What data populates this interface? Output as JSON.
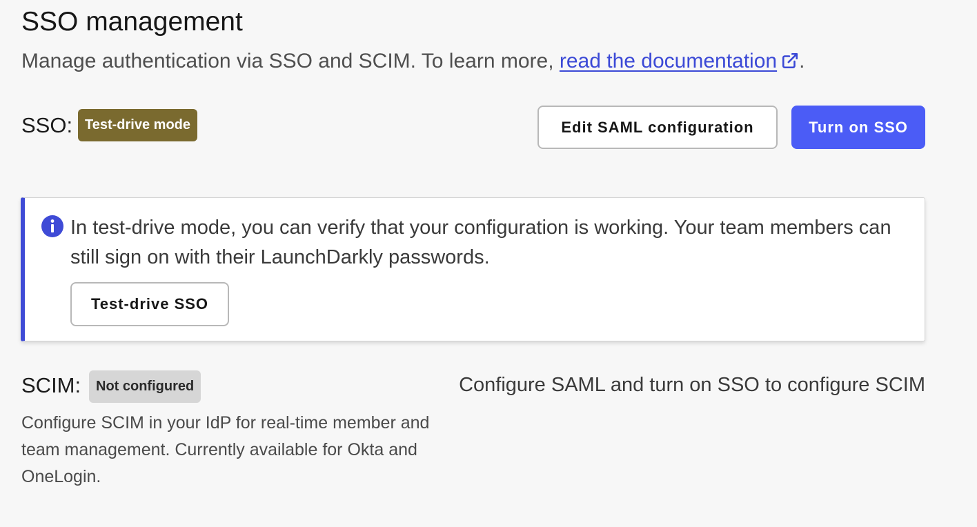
{
  "page": {
    "title": "SSO management",
    "subtitle_text": "Manage authentication via SSO and SCIM. To learn more, ",
    "doc_link_text": "read the documentation",
    "subtitle_end": "."
  },
  "sso": {
    "label": "SSO:",
    "status_badge": "Test-drive mode",
    "edit_button": "Edit SAML configuration",
    "turn_on_button": "Turn on SSO"
  },
  "callout": {
    "icon": "info-icon",
    "text": "In test-drive mode, you can verify that your configuration is working. Your team members can still sign on with their LaunchDarkly passwords.",
    "button": "Test-drive SSO"
  },
  "scim": {
    "label": "SCIM:",
    "status_badge": "Not configured",
    "description": "Configure SCIM in your IdP for real-time member and team management. Currently available for Okta and OneLogin.",
    "hint": "Configure SAML and turn on SSO to configure SCIM"
  },
  "colors": {
    "background": "#f7f7f7",
    "link": "#3b49d6",
    "primary_button": "#4b5cf6",
    "test_drive_badge": "#7a6a2f",
    "not_configured_badge": "#d6d6d6",
    "callout_accent": "#3f4bd6"
  }
}
